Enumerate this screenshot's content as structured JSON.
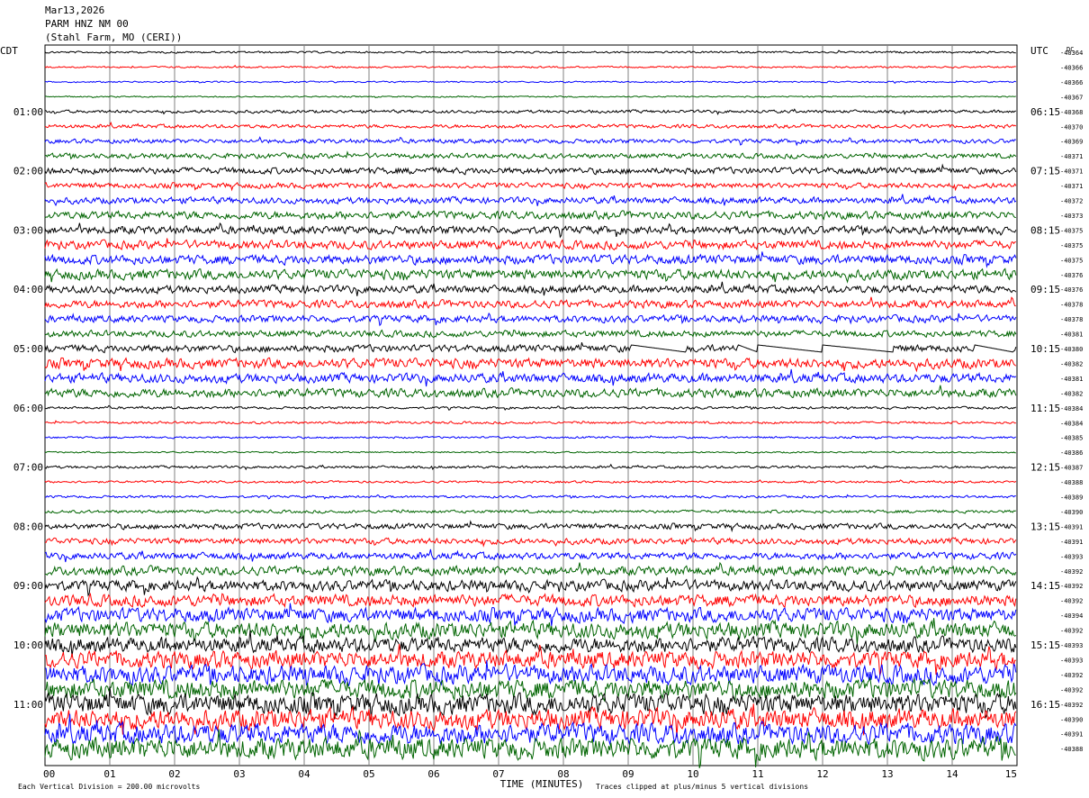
{
  "header": {
    "date": "Mar13,2026",
    "station": "PARM HNZ NM 00",
    "location": "(Stahl Farm, MO (CERI))"
  },
  "labels": {
    "left_tz": "CDT",
    "right_tz": "UTC",
    "dc": "DC",
    "footer_left": "Each Vertical Division =  200.00 microvolts",
    "footer_center": "TIME (MINUTES)",
    "footer_right": "Traces clipped at plus/minus 5 vertical divisions"
  },
  "colors": {
    "cycle": [
      "#000000",
      "#ff0000",
      "#0000ff",
      "#006400"
    ],
    "grid": "#808080"
  },
  "chart_data": {
    "type": "line",
    "title": "PARM HNZ NM 00",
    "xlabel": "TIME (MINUTES)",
    "x_ticks": [
      "00",
      "01",
      "02",
      "03",
      "04",
      "05",
      "06",
      "07",
      "08",
      "09",
      "10",
      "11",
      "12",
      "13",
      "14",
      "15"
    ],
    "xlim": [
      0,
      15
    ],
    "num_traces": 48,
    "left_hour_labels": [
      "01:00",
      "02:00",
      "03:00",
      "04:00",
      "05:00",
      "06:00",
      "07:00",
      "08:00",
      "09:00",
      "10:00",
      "11:00"
    ],
    "right_hour_labels": [
      "06:15",
      "07:15",
      "08:15",
      "09:15",
      "10:15",
      "11:15",
      "12:15",
      "13:15",
      "14:15",
      "15:15",
      "16:15"
    ],
    "dc_offsets": [
      -40364,
      -40366,
      -40366,
      -40367,
      -40368,
      -40370,
      -40369,
      -40371,
      -40371,
      -40371,
      -40372,
      -40373,
      -40375,
      -40375,
      -40375,
      -40376,
      -40376,
      -40378,
      -40378,
      -40381,
      -40380,
      -40382,
      -40381,
      -40382,
      -40384,
      -40384,
      -40385,
      -40386,
      -40387,
      -40388,
      -40389,
      -40390,
      -40391,
      -40391,
      -40393,
      -40392,
      -40392,
      -40392,
      -40394,
      -40392,
      -40393,
      -40393,
      -40392,
      -40392,
      -40392,
      -40390,
      -40391,
      -40388
    ],
    "trace_amplitude": [
      0.9,
      0.8,
      0.7,
      0.6,
      1.4,
      1.7,
      2.0,
      2.3,
      3.0,
      2.5,
      3.0,
      3.6,
      3.6,
      4.0,
      4.3,
      4.6,
      3.6,
      3.6,
      3.3,
      3.0,
      3.3,
      4.6,
      4.3,
      4.0,
      1.1,
      1.1,
      0.9,
      0.7,
      1.2,
      1.0,
      1.1,
      1.4,
      2.6,
      2.8,
      3.2,
      4.2,
      5.0,
      5.5,
      6.5,
      7.5,
      7.0,
      8.0,
      8.5,
      9.0,
      9.5,
      9.5,
      9.5,
      10.0
    ],
    "gaps": [
      {
        "trace": 20,
        "segments": [
          [
            9.05,
            9.9
          ],
          [
            10.7,
            11.0
          ],
          [
            11.0,
            12.0
          ],
          [
            12.0,
            13.1
          ],
          [
            14.35,
            14.95
          ]
        ]
      }
    ]
  }
}
